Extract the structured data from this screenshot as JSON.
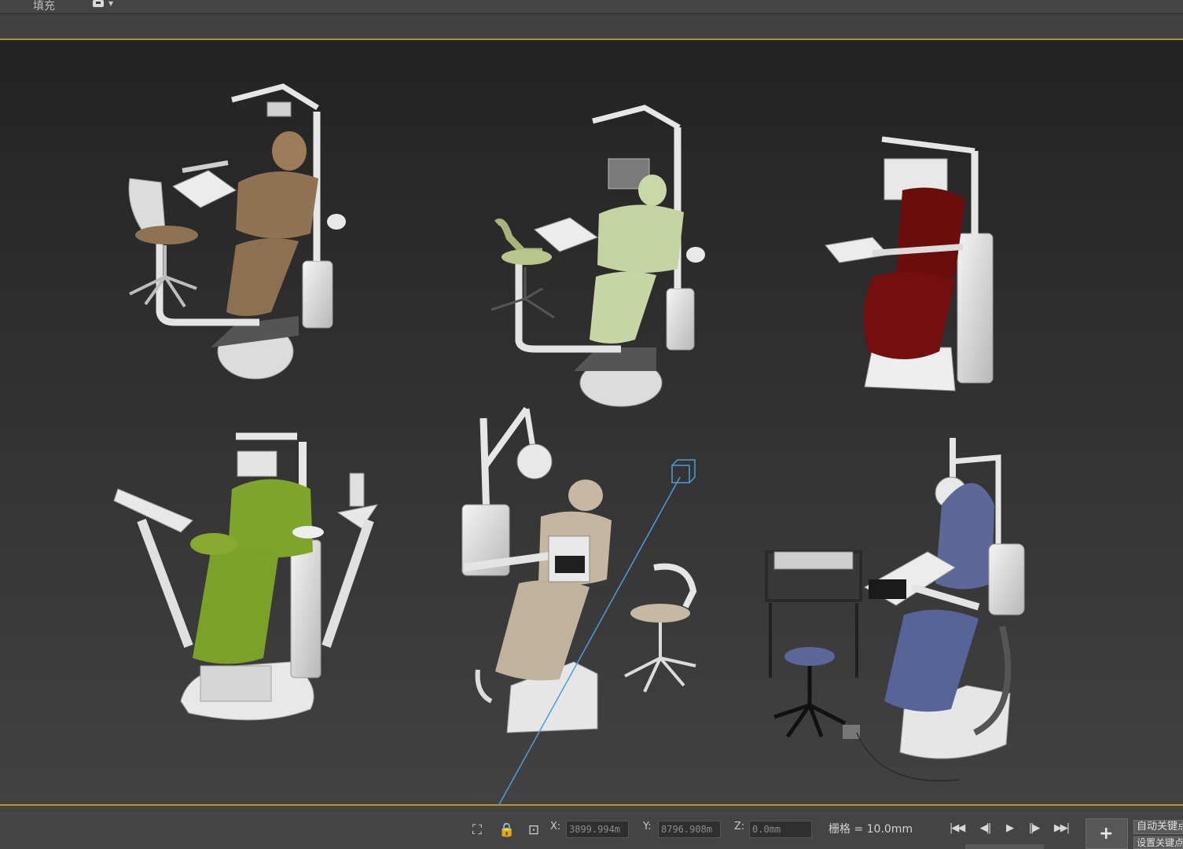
{
  "toolbar": {
    "fill_label": "填充",
    "dropdown_icon": "layer-dropdown-icon"
  },
  "viewport": {
    "border_color": "#b39232",
    "background_top": "#232323",
    "background_bottom": "#424242",
    "models": [
      {
        "name": "dental-chair-brown",
        "upholstery_color": "#8e7252"
      },
      {
        "name": "dental-chair-light-green",
        "upholstery_color": "#c9d7a5"
      },
      {
        "name": "dental-chair-dark-red",
        "upholstery_color": "#6e1010"
      },
      {
        "name": "dental-chair-lime-green",
        "upholstery_color": "#7fa42a"
      },
      {
        "name": "dental-chair-beige",
        "upholstery_color": "#c4b6a0"
      },
      {
        "name": "dental-chair-blue",
        "upholstery_color": "#5a6798"
      }
    ]
  },
  "status": {
    "x_label": "X:",
    "x_value": "3899.994m",
    "y_label": "Y:",
    "y_value": "8796.908m",
    "z_label": "Z:",
    "z_value": "0.0mm",
    "grid_text": "栅格 = 10.0mm",
    "auto_key_label": "自动关键点",
    "set_key_label": "设置关键点",
    "icons": [
      "selection-lock-icon",
      "absolute-mode-icon",
      "isolate-icon"
    ],
    "playback": [
      "go-to-start-icon",
      "previous-frame-icon",
      "play-icon",
      "next-frame-icon",
      "go-to-end-icon"
    ],
    "key_mode_icon": "set-key-icon"
  }
}
